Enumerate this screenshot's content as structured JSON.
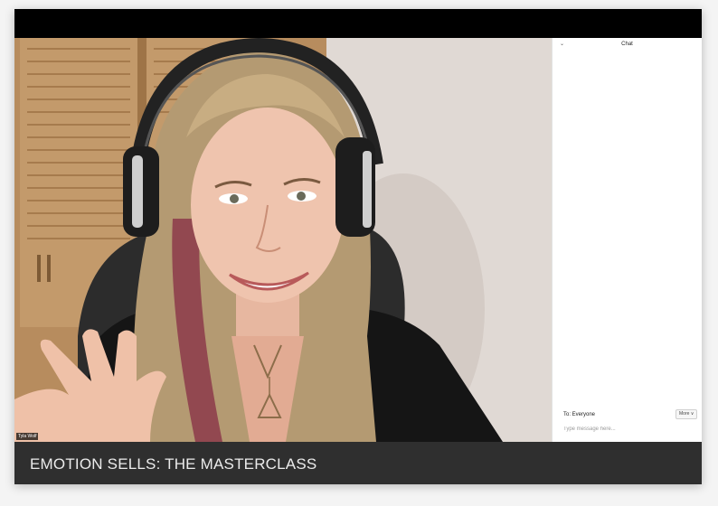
{
  "chat": {
    "collapse_icon": "chevron-down-icon",
    "title": "Chat",
    "to_label": "To: Everyone",
    "more_label": "More ∨",
    "input_placeholder": "Type message here..."
  },
  "video": {
    "participant_name": "Tyla Wolf"
  },
  "banner": {
    "title": "EMOTION SELLS: THE MASTERCLASS"
  },
  "colors": {
    "title_bar": "#2f2f2f",
    "top_bar": "#000000",
    "chat_bg": "#ffffff"
  }
}
